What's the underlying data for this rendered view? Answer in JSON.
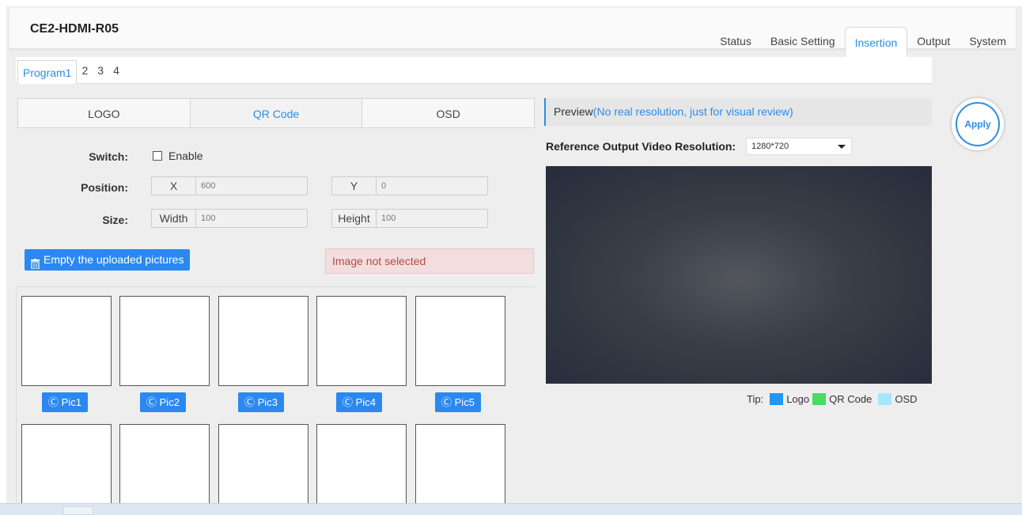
{
  "header": {
    "device_title": "CE2-HDMI-R05",
    "nav": [
      {
        "label": "Status",
        "active": false
      },
      {
        "label": "Basic Setting",
        "active": false
      },
      {
        "label": "Insertion",
        "active": true
      },
      {
        "label": "Output",
        "active": false
      },
      {
        "label": "System",
        "active": false
      }
    ]
  },
  "program_tabs": [
    "Program1",
    "2",
    "3",
    "4"
  ],
  "sub_tabs": {
    "logo": "LOGO",
    "qr": "QR Code",
    "osd": "OSD",
    "active": "QR Code"
  },
  "form": {
    "switch_label": "Switch:",
    "enable_label": "Enable",
    "enabled": false,
    "position_label": "Position:",
    "x_prefix": "X",
    "x_value": "600",
    "y_prefix": "Y",
    "y_value": "0",
    "size_label": "Size:",
    "width_prefix": "Width",
    "width_value": "100",
    "height_prefix": "Height",
    "height_value": "100"
  },
  "empty_button": "Empty the uploaded pictures",
  "alert_text": "Image not selected",
  "pictures": [
    "Pic1",
    "Pic2",
    "Pic3",
    "Pic4",
    "Pic5"
  ],
  "preview": {
    "title": "Preview",
    "hint": "(No real resolution, just for visual review)",
    "resolution_label": "Reference Output Video Resolution:",
    "resolution_value": "1280*720"
  },
  "tip": {
    "label": "Tip:",
    "items": [
      {
        "label": "Logo",
        "color": "#2196f3"
      },
      {
        "label": "QR Code",
        "color": "#4cd964"
      },
      {
        "label": "OSD",
        "color": "#a8e6ff"
      }
    ]
  },
  "apply_label": "Apply",
  "colors": {
    "accent": "#2a8de8",
    "button": "#2b88f0",
    "alert_bg": "#f2dede"
  }
}
